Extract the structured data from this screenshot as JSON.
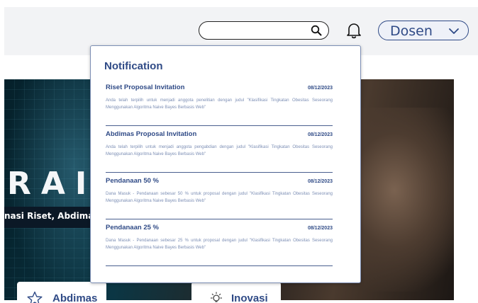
{
  "header": {
    "search": {
      "placeholder": ""
    },
    "role_selector": {
      "value": "Dosen"
    }
  },
  "hero": {
    "title": "RAI",
    "subtitle": "nasi Riset, Abdimas, In"
  },
  "cards": [
    {
      "label": "Abdimas",
      "icon": "star-icon"
    },
    {
      "label": "Inovasi",
      "icon": "lightbulb-icon"
    }
  ],
  "notifications": {
    "title": "Notification",
    "items": [
      {
        "title": "Riset Proposal Invitation",
        "date": "08/12/2023",
        "body": "Anda telah terpilih untuk menjadi anggota penelitian dengan judul \"Klasifikasi Tingkatan Obesitas Seseorang Menggunakan Algoritma Naive Bayes Berbasis Web\""
      },
      {
        "title": "Abdimas Proposal Invitation",
        "date": "08/12/2023",
        "body": "Anda telah terpilih untuk menjadi anggota pengabdian dengan judul \"Klasifikasi Tingkatan Obesitas Seseorang Menggunakan Algoritma Naive Bayes Berbasis Web\""
      },
      {
        "title": "Pendanaan 50 %",
        "date": "08/12/2023",
        "body": "Dana Masuk - Pendanaan sebesar 50 %  untuk proposal dengan judul \"Klasifikasi Tingkatan Obesitas Seseorang Menggunakan Algoritma Naive Bayes Berbasis Web\""
      },
      {
        "title": "Pendanaan 25 %",
        "date": "08/12/2023",
        "body": "Dana Masuk - Pendanaan sebesar 25 %  untuk proposal dengan judul \"Klasifikasi Tingkatan Obesitas Seseorang Menggunakan Algoritma Naive Bayes Berbasis Web\""
      }
    ]
  },
  "colors": {
    "accent": "#2f4a86",
    "muted_text": "#7d8fb5",
    "header_bg": "#f2f3f5"
  }
}
